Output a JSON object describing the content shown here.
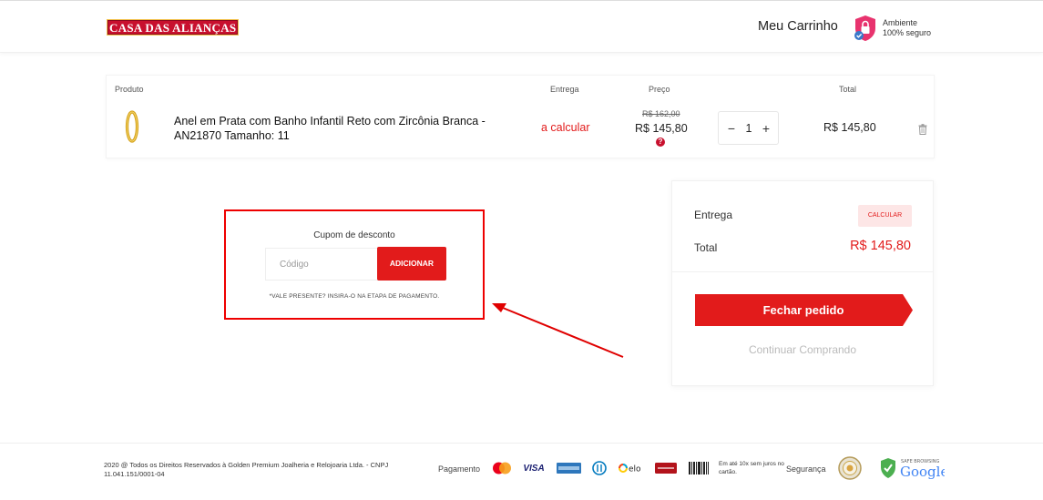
{
  "header": {
    "logo_text": "CASA DAS ALIANÇAS",
    "cart_title": "Meu Carrinho",
    "secure_line1": "Ambiente",
    "secure_line2": "100% seguro"
  },
  "table": {
    "headers": {
      "product": "Produto",
      "delivery": "Entrega",
      "price": "Preço",
      "total": "Total"
    },
    "item": {
      "name": "Anel em Prata com Banho Infantil Reto com Zircônia Branca - AN21870 Tamanho: 11",
      "delivery": "a calcular",
      "old_price": "R$ 162,00",
      "price": "R$ 145,80",
      "quantity": "1",
      "total": "R$ 145,80"
    }
  },
  "coupon": {
    "title": "Cupom de desconto",
    "placeholder": "Código",
    "button": "ADICIONAR",
    "note": "*VALE PRESENTE? INSIRA-O NA ETAPA DE PAGAMENTO."
  },
  "summary": {
    "delivery_label": "Entrega",
    "calc_button": "CALCULAR",
    "total_label": "Total",
    "total_value": "R$ 145,80",
    "close_order": "Fechar pedido",
    "continue_shopping": "Continuar Comprando"
  },
  "footer": {
    "copyright": "2020 @ Todos os Direitos Reservados à Golden Premium Joalheria e Relojoaria Ltda. - CNPJ 11.041.151/0001-04",
    "payment_label": "Pagamento",
    "payment_methods": [
      "mastercard",
      "VISA",
      "american express",
      "diners",
      "elo",
      "hipercard",
      "boleto"
    ],
    "installments": "Em até 10x sem juros no cartão.",
    "security_label": "Segurança",
    "safe_browsing_top": "SAFE BROWSING",
    "safe_browsing_brand": "Google"
  },
  "colors": {
    "accent": "#e21b1b",
    "calc_bg": "#fde6e6",
    "annotation": "#e00000"
  },
  "icons": {
    "secure": "shield-lock-icon",
    "help": "question-circle-icon",
    "trash": "trash-icon",
    "minus": "minus-icon",
    "plus": "plus-icon"
  }
}
